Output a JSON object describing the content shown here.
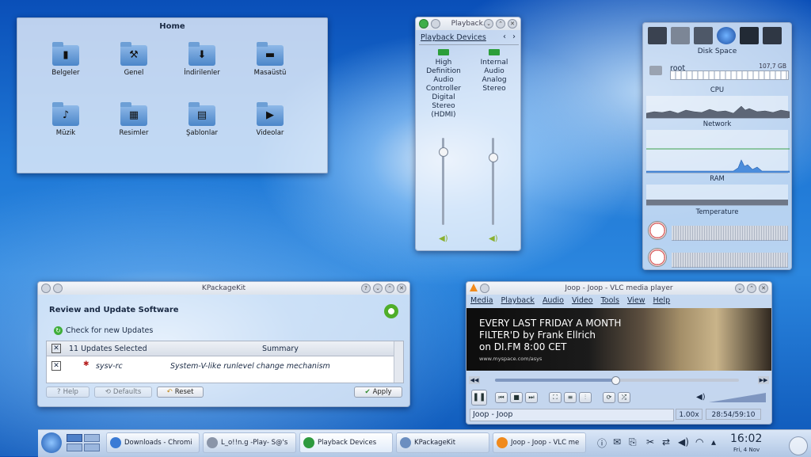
{
  "home": {
    "title": "Home",
    "items": [
      {
        "label": "Belgeler",
        "icon": "documents-folder-icon",
        "glyph": "▮"
      },
      {
        "label": "Genel",
        "icon": "public-folder-icon",
        "glyph": "⚒"
      },
      {
        "label": "İndirilenler",
        "icon": "downloads-folder-icon",
        "glyph": "⬇"
      },
      {
        "label": "Masaüstü",
        "icon": "desktop-folder-icon",
        "glyph": "▬"
      },
      {
        "label": "Müzik",
        "icon": "music-folder-icon",
        "glyph": "♪"
      },
      {
        "label": "Resimler",
        "icon": "pictures-folder-icon",
        "glyph": "▦"
      },
      {
        "label": "Şablonlar",
        "icon": "templates-folder-icon",
        "glyph": "▤"
      },
      {
        "label": "Videolar",
        "icon": "videos-folder-icon",
        "glyph": "▶"
      }
    ]
  },
  "mixer": {
    "title": "Playback...",
    "tab": "Playback Devices",
    "channels": [
      {
        "label": "High Definition Audio Controller Digital Stereo (HDMI)",
        "level": 0.85
      },
      {
        "label": "Internal Audio Analog Stereo",
        "level": 0.78
      }
    ]
  },
  "sysmon": {
    "disk_label": "Disk Space",
    "root_label": "root",
    "root_size": "107,7 GB",
    "cpu_label": "CPU",
    "network_label": "Network",
    "ram_label": "RAM",
    "temp_label": "Temperature"
  },
  "kpk": {
    "title": "KPackageKit",
    "heading": "Review and Update Software",
    "check_link": "Check for new Updates",
    "selected": "11 Updates Selected",
    "summary_header": "Summary",
    "row": {
      "name": "sysv-rc",
      "summary": "System-V-like runlevel change mechanism"
    },
    "help": "Help",
    "defaults": "Defaults",
    "reset": "Reset",
    "apply": "Apply"
  },
  "vlc": {
    "title": "Joop - Joop - VLC media player",
    "menu": [
      "Media",
      "Playback",
      "Audio",
      "Video",
      "Tools",
      "View",
      "Help"
    ],
    "video_text": [
      "EVERY LAST FRIDAY A MONTH",
      "FILTER'D by Frank Ellrich",
      "on DI.FM 8:00 CET"
    ],
    "video_url": "www.myspace.com/asys",
    "now_playing": "Joop - Joop",
    "rate": "1.00x",
    "time": "28:54/59:10",
    "progress": 0.49
  },
  "taskbar": {
    "tasks": [
      {
        "label": "Downloads - Chromi",
        "color": "#3a7bd5"
      },
      {
        "label": "L_o!!n.g -Play- S@'s",
        "color": "#8a95a8"
      },
      {
        "label": "Playback Devices",
        "color": "#2e9a3e"
      },
      {
        "label": "KPackageKit",
        "color": "#6b8ec0"
      },
      {
        "label": "Joop - Joop - VLC me",
        "color": "#f08a1c"
      }
    ],
    "clock": "16:02",
    "date": "Fri, 4 Nov"
  }
}
